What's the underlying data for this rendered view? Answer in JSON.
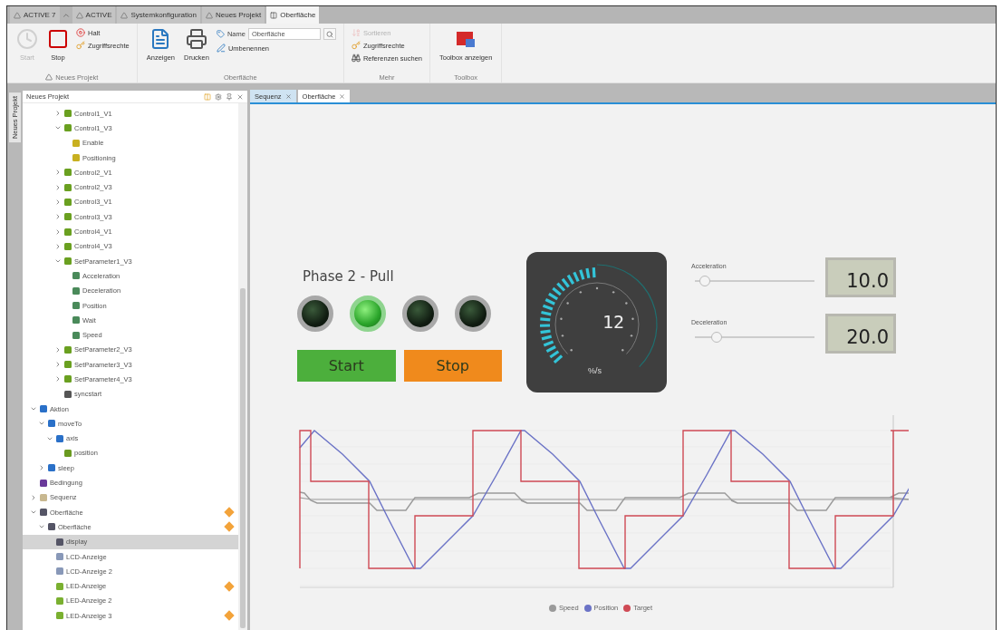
{
  "app_tabs": [
    {
      "label": "ACTIVE 7",
      "selected": false
    },
    {
      "label": "ACTIVE",
      "selected": false
    },
    {
      "label": "Systemkonfiguration",
      "selected": false
    },
    {
      "label": "Neues Projekt",
      "selected": false
    },
    {
      "label": "Oberfläche",
      "selected": true
    }
  ],
  "ribbon": {
    "groups": [
      {
        "label": "Neues Projekt",
        "items": [
          {
            "label": "Start",
            "kind": "large",
            "disabled": true
          },
          {
            "label": "Stop",
            "kind": "large",
            "disabled": false
          },
          {
            "label": "Halt",
            "kind": "small",
            "disabled": false
          },
          {
            "label": "Zugriffsrechte",
            "kind": "small",
            "disabled": false
          }
        ]
      },
      {
        "label": "Oberfläche",
        "items": [
          {
            "label": "Anzeigen",
            "kind": "large",
            "disabled": false
          },
          {
            "label": "Drucken",
            "kind": "large",
            "disabled": false
          },
          {
            "label": "Name",
            "kind": "field",
            "value": "Oberfläche"
          },
          {
            "label": "Umbenennen",
            "kind": "small",
            "disabled": false
          }
        ]
      },
      {
        "label": "Mehr",
        "items": [
          {
            "label": "Sortieren",
            "kind": "small",
            "disabled": true
          },
          {
            "label": "Zugriffsrechte",
            "kind": "small",
            "disabled": false
          },
          {
            "label": "Referenzen suchen",
            "kind": "small",
            "disabled": false
          }
        ]
      },
      {
        "label": "Toolbox",
        "items": [
          {
            "label": "Toolbox anzeigen",
            "kind": "large",
            "disabled": false
          }
        ]
      }
    ]
  },
  "side_tab": "Neues Projekt",
  "tree": {
    "title": "Neues Projekt",
    "items": [
      {
        "children": [
          {
            "label": "Control1_V1",
            "kind": "component",
            "expanded": false,
            "selected": false
          },
          {
            "label": "Control1_V3",
            "kind": "component",
            "expanded": true,
            "selected": false,
            "children": [
              {
                "label": "Enable",
                "kind": "signal",
                "selected": false
              },
              {
                "label": "Positioning",
                "kind": "signal",
                "selected": false
              }
            ]
          },
          {
            "label": "Control2_V1",
            "kind": "component",
            "expanded": false,
            "selected": false
          },
          {
            "label": "Control2_V3",
            "kind": "component",
            "expanded": false,
            "selected": false
          },
          {
            "label": "Control3_V1",
            "kind": "component",
            "expanded": false,
            "selected": false
          },
          {
            "label": "Control3_V3",
            "kind": "component",
            "expanded": false,
            "selected": false
          },
          {
            "label": "Control4_V1",
            "kind": "component",
            "expanded": false,
            "selected": false
          },
          {
            "label": "Control4_V3",
            "kind": "component",
            "expanded": false,
            "selected": false
          },
          {
            "label": "SetParameter1_V3",
            "kind": "component",
            "expanded": true,
            "selected": false,
            "children": [
              {
                "label": "Acceleration",
                "kind": "parameter",
                "selected": false
              },
              {
                "label": "Deceleration",
                "kind": "parameter",
                "selected": false
              },
              {
                "label": "Position",
                "kind": "parameter",
                "selected": false
              },
              {
                "label": "Wait",
                "kind": "parameter",
                "selected": false
              },
              {
                "label": "Speed",
                "kind": "parameter",
                "selected": false
              }
            ]
          },
          {
            "label": "SetParameter2_V3",
            "kind": "component",
            "expanded": false,
            "selected": false
          },
          {
            "label": "SetParameter3_V3",
            "kind": "component",
            "expanded": false,
            "selected": false
          },
          {
            "label": "SetParameter4_V3",
            "kind": "component",
            "expanded": false,
            "selected": false
          },
          {
            "label": "syncstart",
            "kind": "sync",
            "selected": false
          }
        ]
      },
      {
        "label": "Aktion",
        "kind": "action",
        "expanded": true,
        "selected": false,
        "children": [
          {
            "label": "moveTo",
            "kind": "action",
            "expanded": true,
            "selected": false,
            "children": [
              {
                "label": "axis",
                "kind": "axis",
                "expanded": true,
                "selected": false,
                "children": [
                  {
                    "label": "position",
                    "kind": "variable",
                    "selected": false
                  }
                ]
              }
            ]
          },
          {
            "label": "sleep",
            "kind": "action",
            "expanded": false,
            "selected": false
          }
        ]
      },
      {
        "label": "Bedingung",
        "kind": "condition",
        "selected": false
      },
      {
        "label": "Sequenz",
        "kind": "sequence",
        "expanded": false,
        "selected": false
      },
      {
        "label": "Oberfläche",
        "kind": "surface",
        "expanded": true,
        "flag": true,
        "selected": false,
        "children": [
          {
            "label": "Oberfläche",
            "kind": "surface",
            "expanded": true,
            "flag": true,
            "selected": false,
            "children": [
              {
                "label": "display",
                "kind": "display",
                "selected": true
              },
              {
                "label": "LCD-Anzeige",
                "kind": "lcd",
                "selected": false
              },
              {
                "label": "LCD-Anzeige 2",
                "kind": "lcd",
                "selected": false
              },
              {
                "label": "LED-Anzeige",
                "kind": "led",
                "flag": true,
                "selected": false
              },
              {
                "label": "LED-Anzeige 2",
                "kind": "led",
                "selected": false
              },
              {
                "label": "LED-Anzeige 3",
                "kind": "led",
                "flag": true,
                "selected": false
              }
            ]
          }
        ]
      }
    ]
  },
  "doc_tabs": [
    {
      "label": "Sequenz",
      "selected": false
    },
    {
      "label": "Oberfläche",
      "selected": true
    }
  ],
  "surface": {
    "phase_label": "Phase 2 - Pull",
    "lamps": [
      {
        "on": false
      },
      {
        "on": true
      },
      {
        "on": false
      },
      {
        "on": false
      }
    ],
    "buttons": [
      {
        "label": "Start",
        "kind": "start"
      },
      {
        "label": "Stop",
        "kind": "stop"
      }
    ],
    "gauge": {
      "value": "12",
      "unit": "%/s"
    },
    "sliders": [
      {
        "label": "Acceleration",
        "level": 0.08,
        "reading": "10.0"
      },
      {
        "label": "Deceleration",
        "level": 0.18,
        "reading": "20.0"
      }
    ],
    "legend": [
      {
        "label": "Speed",
        "color": "#9a9a9a"
      },
      {
        "label": "Position",
        "color": "#6b73c6"
      },
      {
        "label": "Target",
        "color": "#cf4a55"
      }
    ]
  }
}
